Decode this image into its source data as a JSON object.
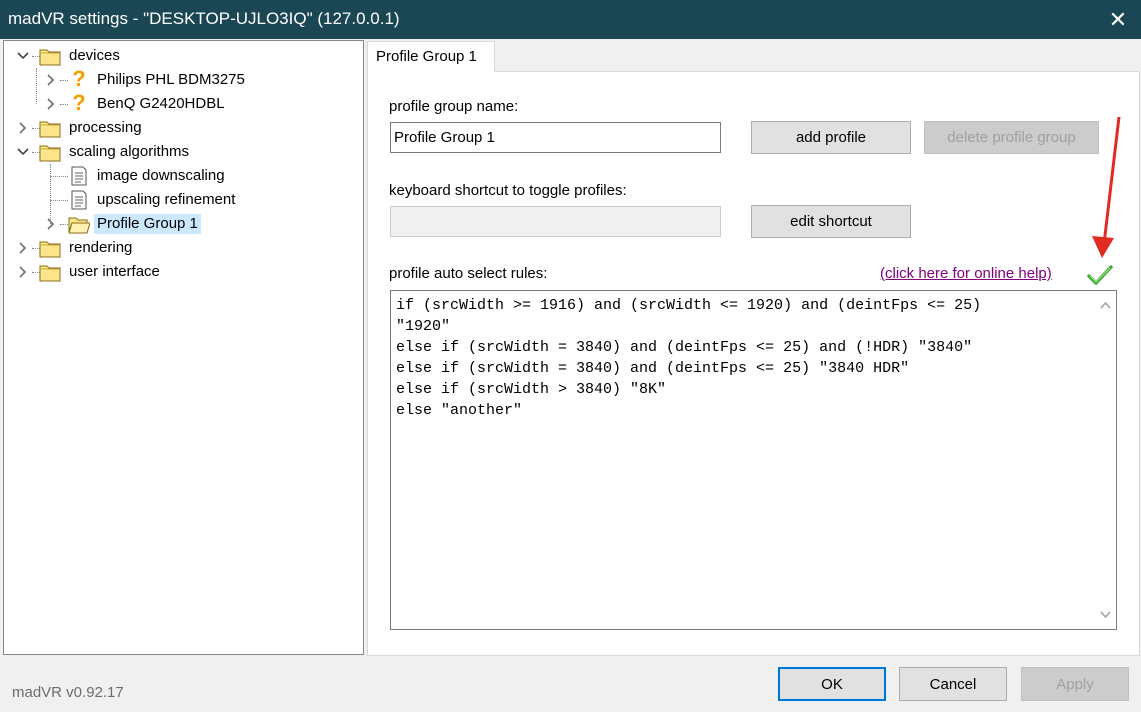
{
  "window": {
    "title": "madVR settings - \"DESKTOP-UJLO3IQ\" (127.0.0.1)",
    "close_glyph": "✕"
  },
  "tree": {
    "items": [
      {
        "label": "devices",
        "icon": "folder-icon",
        "expanded": true
      },
      {
        "label": "Philips PHL BDM3275",
        "icon": "question-icon"
      },
      {
        "label": "BenQ G2420HDBL",
        "icon": "question-icon"
      },
      {
        "label": "processing",
        "icon": "folder-icon",
        "expanded": false
      },
      {
        "label": "scaling algorithms",
        "icon": "folder-icon",
        "expanded": true
      },
      {
        "label": "image downscaling",
        "icon": "document-icon"
      },
      {
        "label": "upscaling refinement",
        "icon": "document-icon"
      },
      {
        "label": "Profile Group 1",
        "icon": "folder-open-icon",
        "selected": true
      },
      {
        "label": "rendering",
        "icon": "folder-icon",
        "expanded": false
      },
      {
        "label": "user interface",
        "icon": "folder-icon",
        "expanded": false
      }
    ]
  },
  "tab": {
    "label": "Profile Group 1"
  },
  "panel": {
    "group_name_label": "profile group name:",
    "group_name_value": "Profile Group 1",
    "add_profile": "add profile",
    "delete_profile_group": "delete profile group",
    "shortcut_label": "keyboard shortcut to toggle profiles:",
    "shortcut_value": "",
    "edit_shortcut": "edit shortcut",
    "rules_label": "profile auto select rules:",
    "help_link": "(click here for online help)",
    "rules_text": "if (srcWidth >= 1916) and (srcWidth <= 1920) and (deintFps <= 25)\n\"1920\"\nelse if (srcWidth = 3840) and (deintFps <= 25) and (!HDR) \"3840\"\nelse if (srcWidth = 3840) and (deintFps <= 25) \"3840 HDR\"\nelse if (srcWidth > 3840) \"8K\"\nelse \"another\""
  },
  "footer": {
    "version": "madVR v0.92.17",
    "ok": "OK",
    "cancel": "Cancel",
    "apply": "Apply"
  },
  "colors": {
    "titlebar": "#1b4654",
    "selection": "#cce8ff",
    "link": "#800080",
    "check": "#3aa935",
    "arrow": "#e02b20"
  }
}
